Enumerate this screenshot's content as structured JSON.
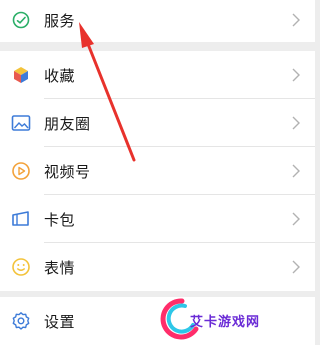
{
  "menu": {
    "items": [
      {
        "label": "服务",
        "icon": "wechat-pay-check-icon",
        "color": "#2aae67"
      },
      {
        "label": "收藏",
        "icon": "favorites-cube-icon",
        "color": "#f3a23a"
      },
      {
        "label": "朋友圈",
        "icon": "moments-photo-icon",
        "color": "#3d7bd8"
      },
      {
        "label": "视频号",
        "icon": "channels-play-icon",
        "color": "#f3a23a"
      },
      {
        "label": "卡包",
        "icon": "card-wallet-icon",
        "color": "#3d7bd8"
      },
      {
        "label": "表情",
        "icon": "sticker-smile-icon",
        "color": "#f3c33a"
      },
      {
        "label": "设置",
        "icon": "settings-gear-icon",
        "color": "#3d7bd8"
      }
    ]
  },
  "watermark": {
    "text": "艾卡游戏网",
    "colors": [
      "#ff2d6a",
      "#2ec7e8",
      "#6a2bd6"
    ]
  },
  "annotation": {
    "arrow_color": "#e8322c"
  }
}
